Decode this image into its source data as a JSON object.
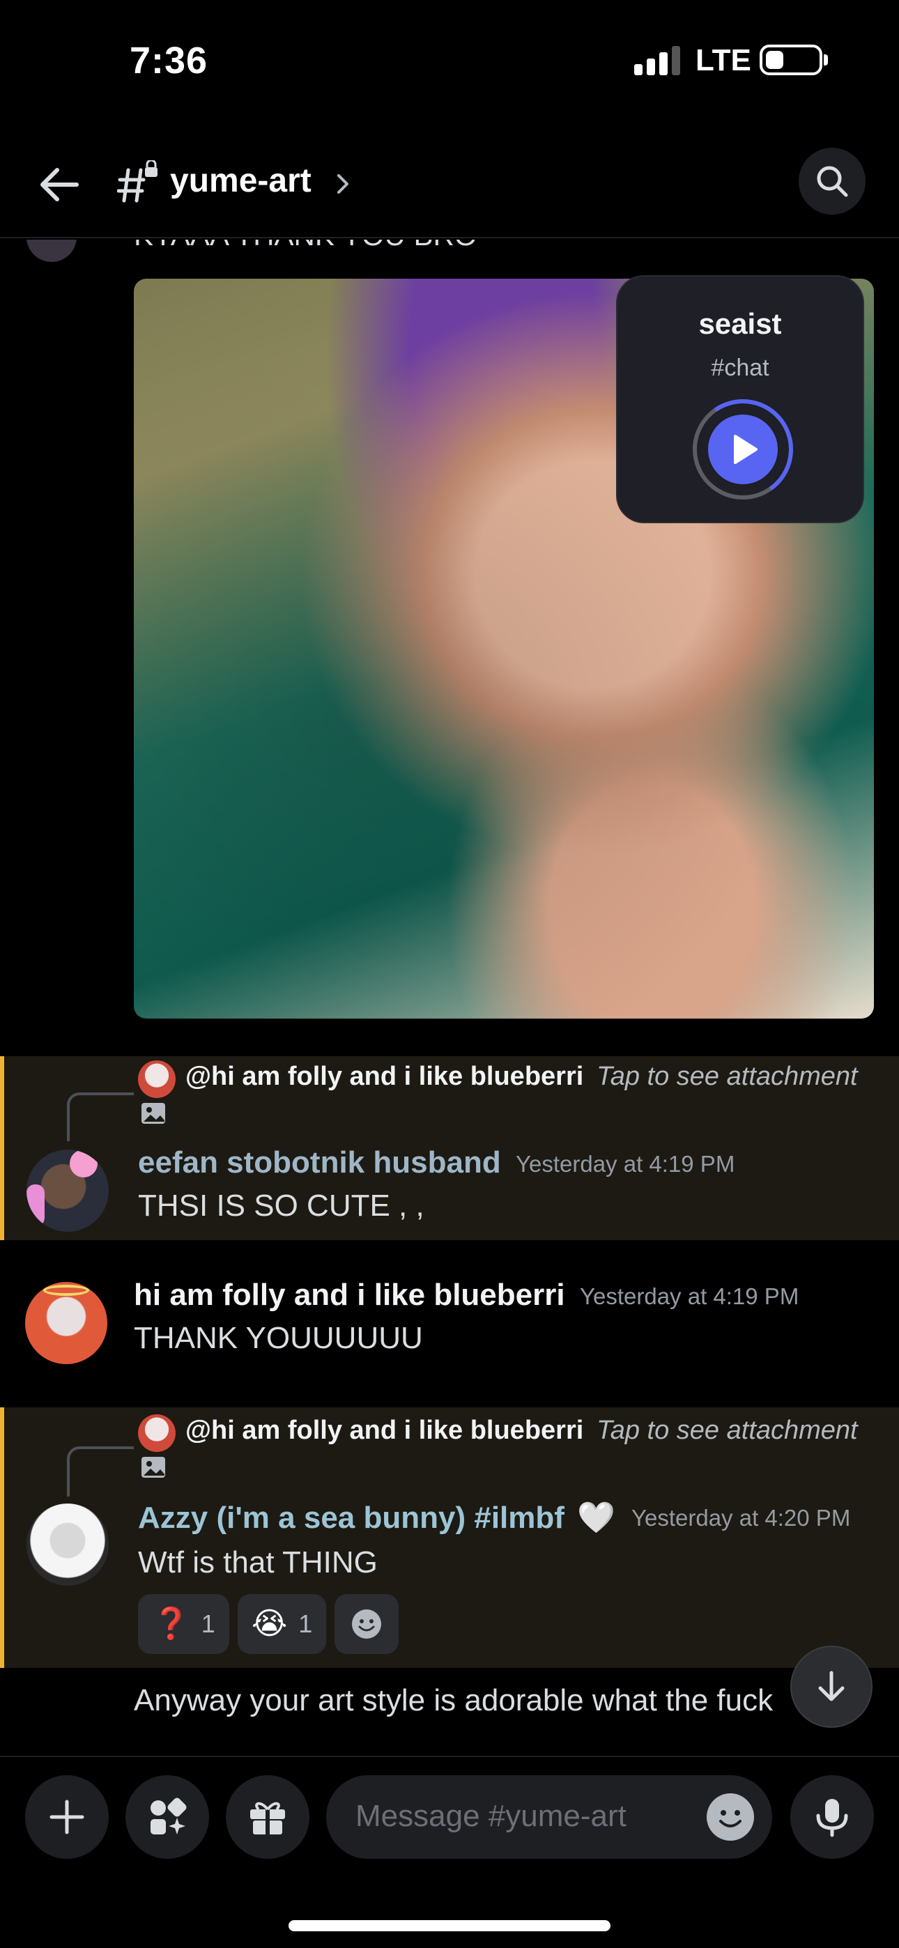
{
  "status_bar": {
    "time": "7:36",
    "network": "LTE",
    "battery_level": 0.35
  },
  "header": {
    "channel_name": "yume-art"
  },
  "partial_message": {
    "text": "KYAAA THANK YOU BRO"
  },
  "voice_overlay": {
    "user": "seaist",
    "channel": "#chat",
    "accent_color": "#5865f2"
  },
  "messages": [
    {
      "reply": {
        "name": "@hi am folly and i like blueberri",
        "tap_text": "Tap to see attachment"
      },
      "author": "eefan stobotnik husband",
      "author_color": "#9fb6c8",
      "timestamp": "Yesterday at 4:19 PM",
      "content": "THSI IS SO CUTE , ,"
    },
    {
      "author": "hi am folly and i like blueberri",
      "author_color": "#f2f3f5",
      "timestamp": "Yesterday at 4:19 PM",
      "content": "THANK YOUUUUUU"
    },
    {
      "reply": {
        "name": "@hi am folly and i like blueberri",
        "tap_text": "Tap to see attachment"
      },
      "author": "Azzy (i'm a sea bunny) #ilmbf",
      "author_badge": "🤍",
      "author_color": "#9cc4d6",
      "timestamp": "Yesterday at 4:20 PM",
      "content": "Wtf is that THING",
      "reactions": [
        {
          "emoji": "❓",
          "count": "1"
        },
        {
          "emoji": "😭",
          "count": "1"
        }
      ]
    },
    {
      "content": "Anyway your art style is adorable what the fuck"
    }
  ],
  "input": {
    "placeholder": "Message #yume-art"
  }
}
